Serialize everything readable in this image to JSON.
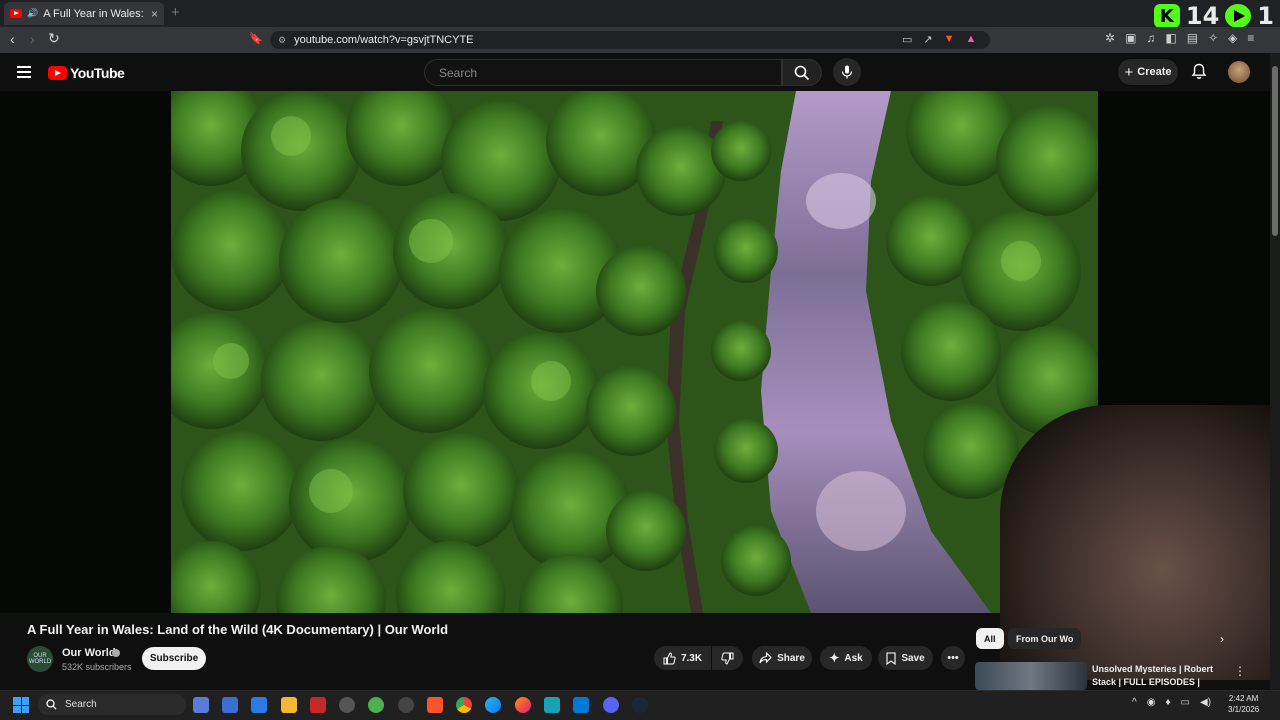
{
  "browser": {
    "tab_title": "A Full Year in Wales: Land of the Wild",
    "tab_close": "×",
    "new_tab": "+",
    "url": "youtube.com/watch?v=gsvjtTNCYTE"
  },
  "overlay": {
    "k_label": "K",
    "count_1": "14",
    "count_2": "1"
  },
  "masthead": {
    "logo_text": "YouTube",
    "search_placeholder": "Search",
    "create_label": "Create"
  },
  "video": {
    "title": "A Full Year in Wales: Land of the Wild (4K Documentary) | Our World",
    "channel": {
      "avatar_text": "OUR WORLD",
      "name": "Our World",
      "subscribers": "532K subscribers"
    },
    "subscribe_label": "Subscribe",
    "actions": {
      "likes": "7.3K",
      "share": "Share",
      "ask": "Ask",
      "save": "Save"
    }
  },
  "sidebar": {
    "chips": [
      "All",
      "From Our Wo"
    ],
    "recommended": {
      "title": "Unsolved Mysteries | Robert Stack | FULL EPISODES |"
    }
  },
  "taskbar": {
    "search_label": "Search",
    "time": "2:42 AM",
    "date": "3/1/2026"
  },
  "colors": {
    "youtube_red": "#ff0000",
    "kick_green": "#53fc18",
    "background": "#0f0f0f"
  }
}
